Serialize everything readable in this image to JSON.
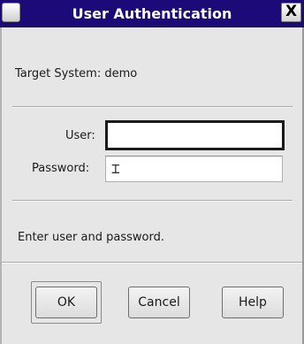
{
  "window": {
    "title": "User Authentication",
    "close_glyph": "X",
    "titlebar_color": "#1c0a78"
  },
  "target": {
    "label": "Target System: demo"
  },
  "form": {
    "user_label": "User:",
    "user_value": "",
    "password_label": "Password:",
    "password_value": ""
  },
  "status": {
    "message": "Enter user and password."
  },
  "buttons": {
    "ok": "OK",
    "cancel": "Cancel",
    "help": "Help"
  },
  "icons": {
    "window_menu": "window-menu-icon",
    "close": "close-icon",
    "text_cursor": "ibeam-cursor-icon"
  }
}
